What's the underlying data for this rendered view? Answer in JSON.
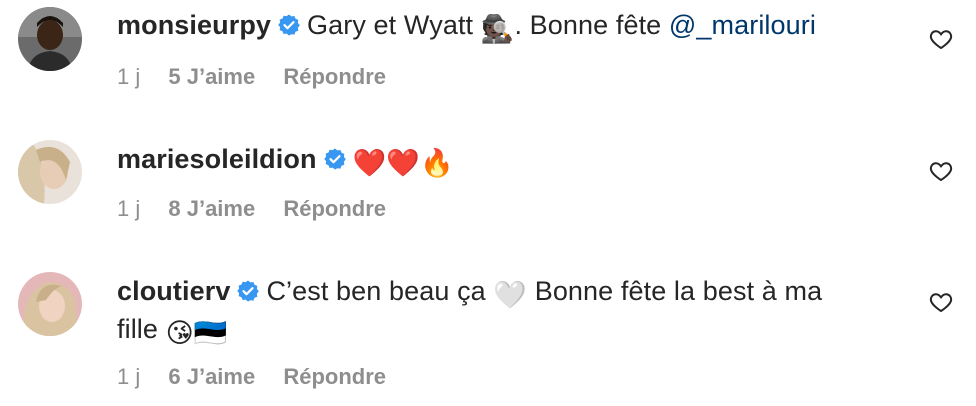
{
  "comments": [
    {
      "username": "monsieurpy",
      "text_before": "Gary et Wyatt ",
      "emoji_1": "🕵🏿",
      "text_after": ". Bonne fête ",
      "mention": "@_marilouri",
      "age": "1 j",
      "likes": "5 J’aime",
      "reply": "Répondre"
    },
    {
      "username": "mariesoleildion",
      "text": "❤️❤️🔥",
      "age": "1 j",
      "likes": "8 J’aime",
      "reply": "Répondre"
    },
    {
      "username": "cloutierv",
      "text_line1": "C’est ben beau ça ",
      "emoji_heart": "🤍",
      "text_line1b": " Bonne fête la best à ma",
      "text_line2": "fille ",
      "emoji_kiss": "😘",
      "emoji_flags": "🇪🇪",
      "age": "1 j",
      "likes": "6 J’aime",
      "reply": "Répondre"
    }
  ],
  "icons": {
    "verified": "verified-badge-icon",
    "like": "heart-outline-icon"
  },
  "colors": {
    "verified_blue": "#3897f0",
    "meta_gray": "#8e8e8e",
    "mention": "#00376b",
    "text": "#262626"
  }
}
